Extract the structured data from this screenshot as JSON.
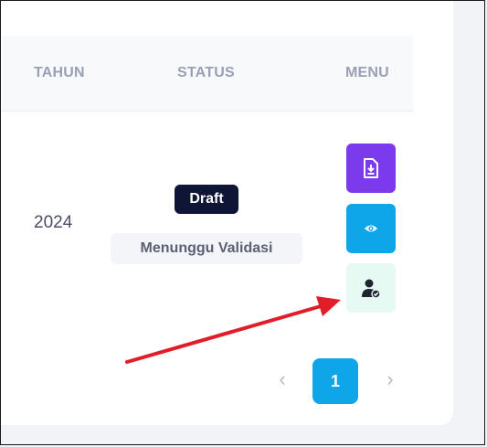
{
  "table": {
    "headers": [
      "TAHUN",
      "STATUS",
      "MENU"
    ],
    "row": {
      "year": "2024",
      "status_badge": "Draft",
      "status_detail": "Menunggu Validasi",
      "menu_icons": [
        "pdf-download-icon",
        "eye-icon",
        "user-check-icon"
      ]
    }
  },
  "pagination": {
    "prev": "‹",
    "current_page": "1",
    "next": "›"
  },
  "colors": {
    "pdf_button": "#7c3aed",
    "view_button": "#0ea5e9",
    "validate_button": "#e6faf3",
    "draft_badge": "#0f1535",
    "annotation_arrow": "#e11d2a"
  }
}
